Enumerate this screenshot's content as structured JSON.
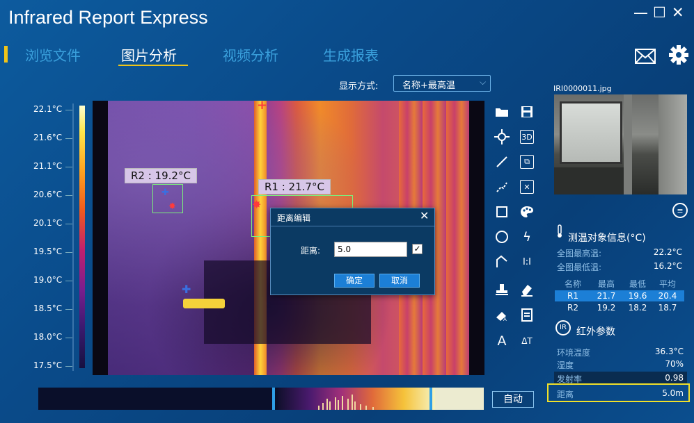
{
  "app": {
    "title": "Infrared Report Express"
  },
  "window": {
    "minimize": "—",
    "maximize": "☐",
    "close": "✕"
  },
  "tabs": [
    {
      "label": "浏览文件",
      "active": false
    },
    {
      "label": "图片分析",
      "active": true
    },
    {
      "label": "视频分析",
      "active": false
    },
    {
      "label": "生成报表",
      "active": false
    }
  ],
  "header_icons": [
    "mail-icon",
    "gear-icon"
  ],
  "display_mode": {
    "label": "显示方式:",
    "value": "名称+最高温"
  },
  "scale": {
    "ticks": [
      "22.1°C",
      "21.6°C",
      "21.1°C",
      "20.6°C",
      "20.1°C",
      "19.5°C",
      "19.0°C",
      "18.5°C",
      "18.0°C",
      "17.5°C"
    ]
  },
  "regions": [
    {
      "label": "R2 : 19.2°C"
    },
    {
      "label": "R1 : 21.7°C"
    }
  ],
  "dialog": {
    "title": "距离编辑",
    "close": "✕",
    "field_label": "距离:",
    "field_value": "5.0",
    "checkbox": "✓",
    "ok": "确定",
    "cancel": "取消"
  },
  "toolbar": {
    "tools": [
      "folder-icon",
      "save-icon",
      "point-icon",
      "3d-icon",
      "line-icon",
      "copy-icon",
      "polyline-icon",
      "delete-icon",
      "rectangle-icon",
      "palette-icon",
      "circle-icon",
      "lightning-icon",
      "polygon-icon",
      "ratio-icon",
      "stamp-icon",
      "eraser-icon",
      "import-icon",
      "export-icon",
      "text-icon",
      "text-size-icon"
    ],
    "labels": {
      "3d": "3D",
      "ratio": "I:I",
      "text": "A",
      "text_size": "ΔT"
    }
  },
  "preview": {
    "file_name": "IRI0000011.jpg"
  },
  "measurement": {
    "title": "测温对象信息(°C)",
    "max_label": "全图最高温:",
    "max_value": "22.2°C",
    "min_label": "全图最低温:",
    "min_value": "16.2°C",
    "columns": [
      "名称",
      "最高",
      "最低",
      "平均"
    ],
    "rows": [
      [
        "R1",
        "21.7",
        "19.6",
        "20.4"
      ],
      [
        "R2",
        "19.2",
        "18.2",
        "18.7"
      ]
    ]
  },
  "ir_params": {
    "badge": "IR",
    "title": "红外参数",
    "items": [
      {
        "label": "环境温度",
        "value": "36.3°C"
      },
      {
        "label": "湿度",
        "value": "70%"
      },
      {
        "label": "发射率",
        "value": "0.98"
      },
      {
        "label": "距离",
        "value": "5.0m"
      }
    ]
  },
  "auto_button": "自动",
  "colors": {
    "accent": "#f0c419",
    "button_blue": "#1c7fd6",
    "highlight_yellow": "#f0e02a",
    "region_box": "#7cf07c"
  }
}
